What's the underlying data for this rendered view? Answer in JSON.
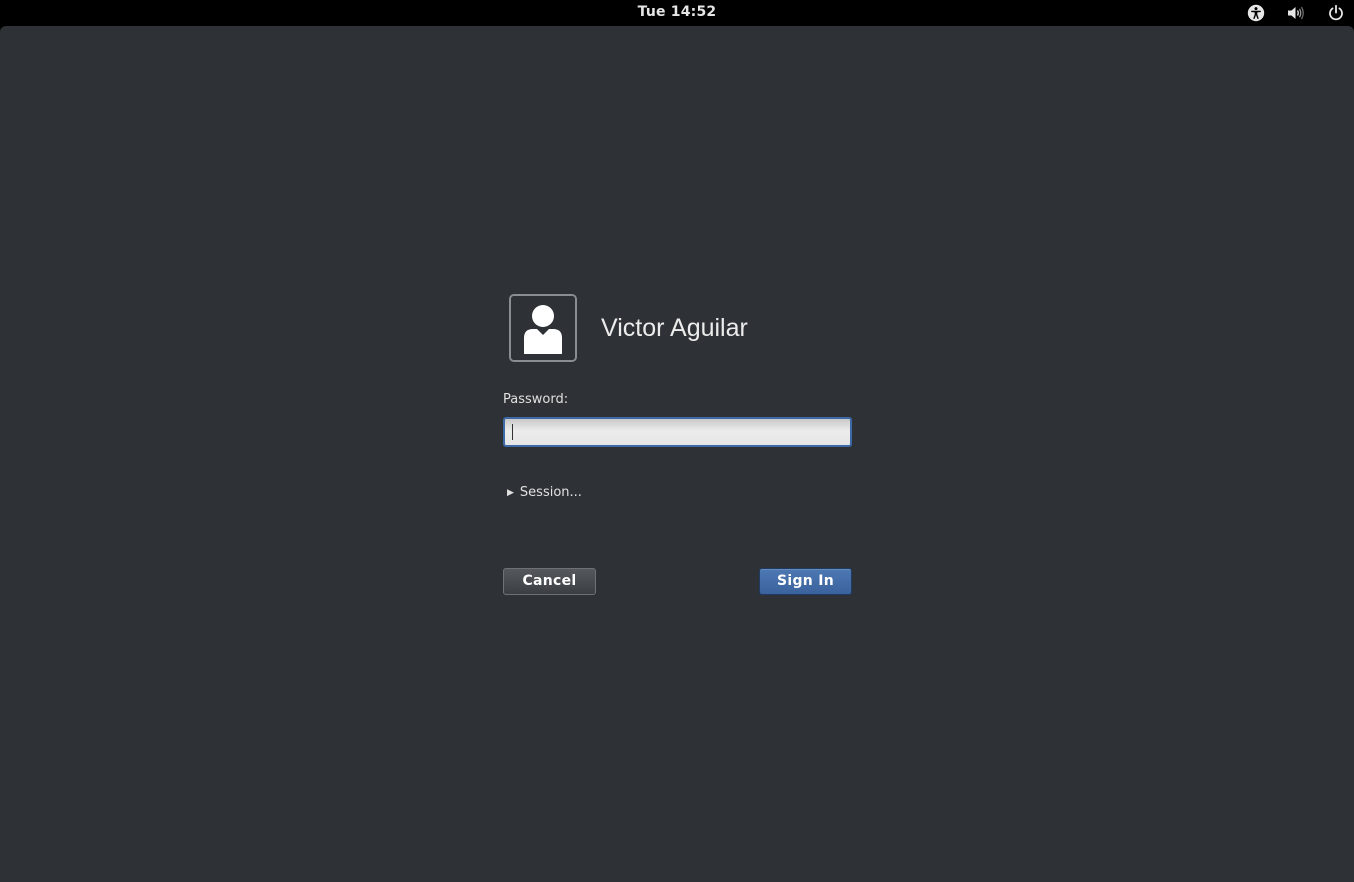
{
  "topbar": {
    "clock": "Tue 14:52",
    "icons": [
      "accessibility-icon",
      "volume-icon",
      "power-icon"
    ]
  },
  "login": {
    "user_name": "Victor Aguilar",
    "avatar_icon": "user-avatar-icon",
    "password_label": "Password:",
    "password_value": "",
    "session_label": "Session...",
    "cancel_label": "Cancel",
    "signin_label": "Sign In"
  },
  "colors": {
    "background": "#2e3236",
    "topbar": "#000000",
    "accent": "#3d6aa7"
  }
}
